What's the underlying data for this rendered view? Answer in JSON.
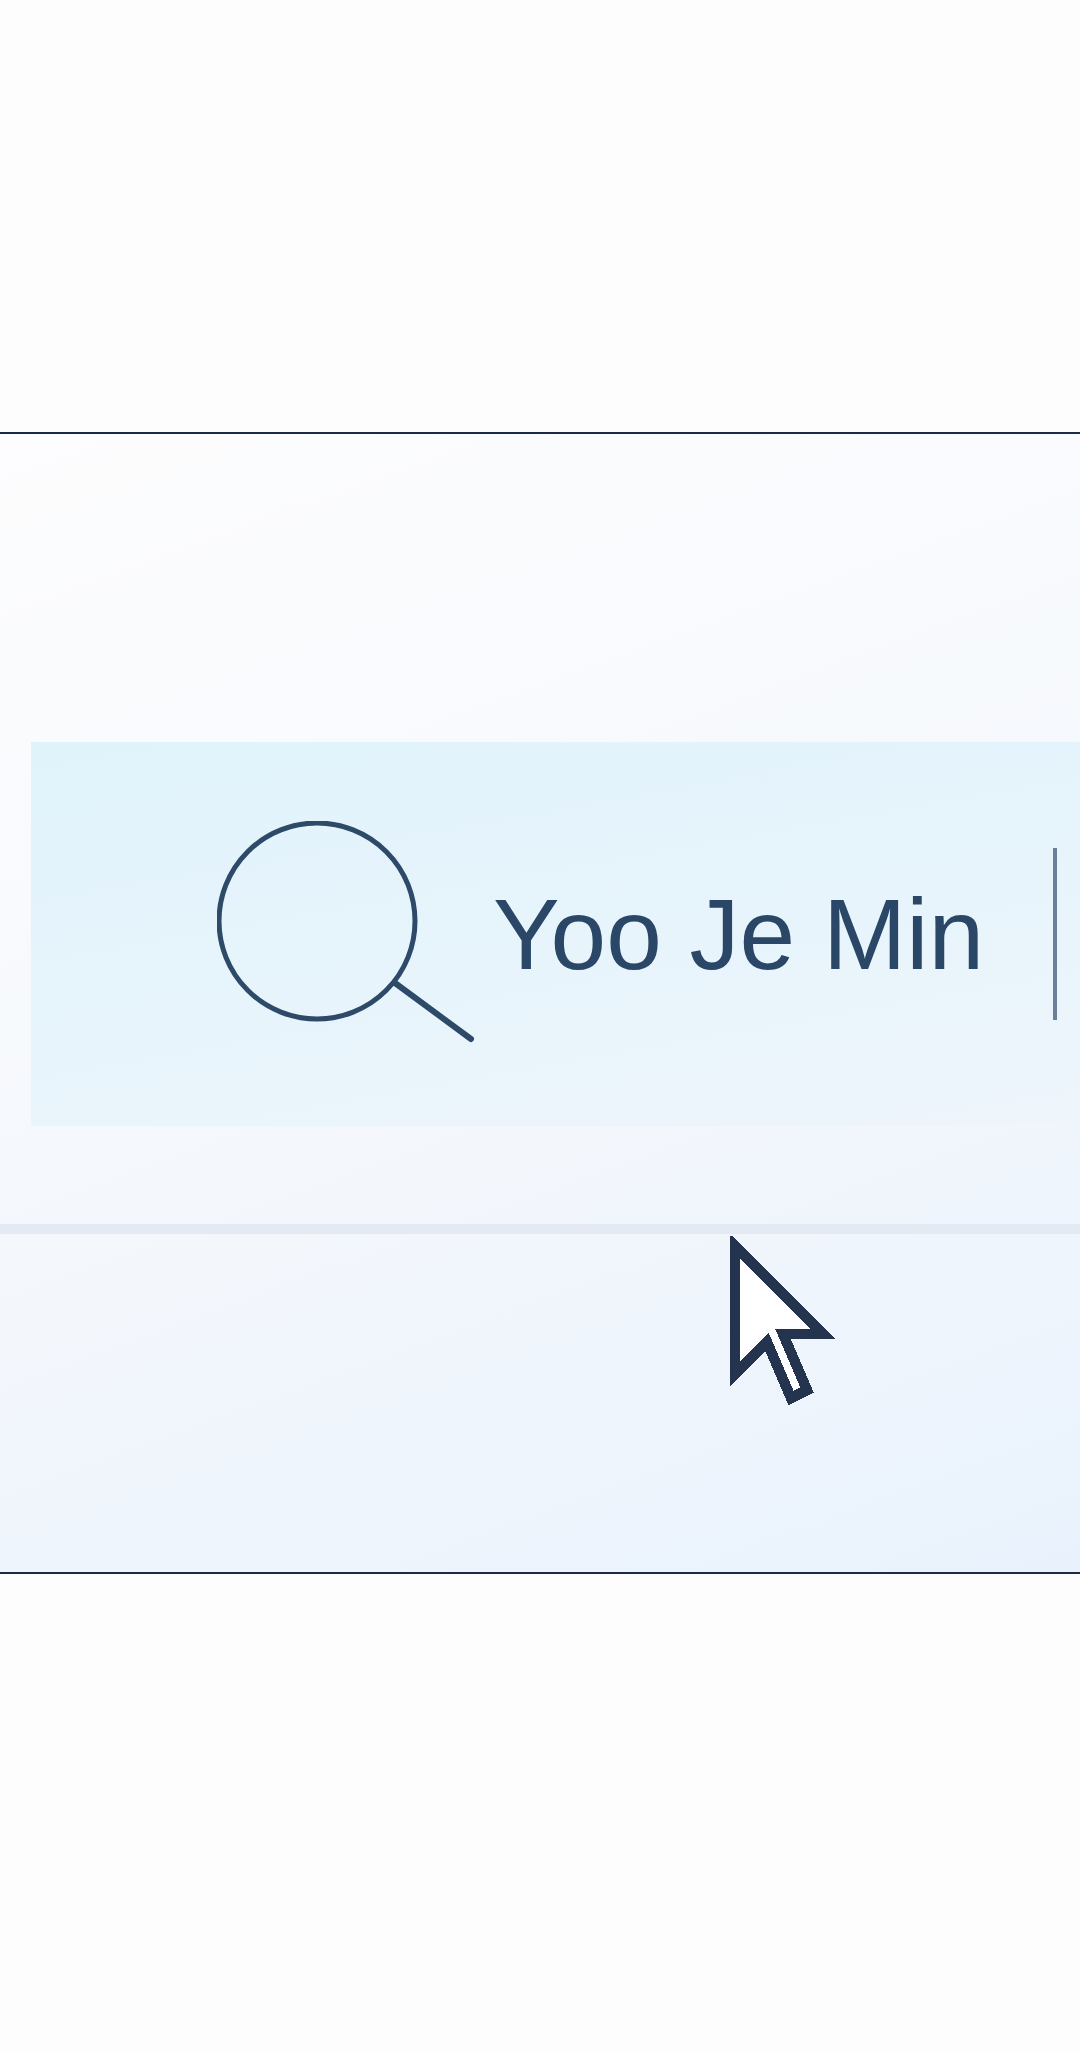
{
  "search": {
    "value": "Yoo Je Min"
  }
}
